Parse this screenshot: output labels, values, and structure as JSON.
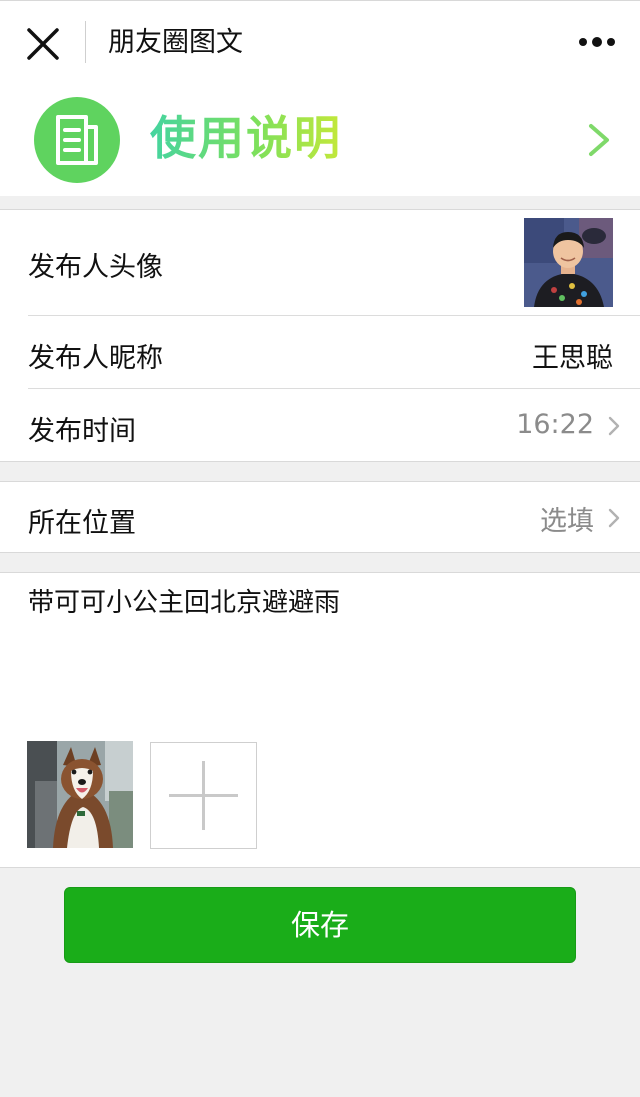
{
  "header": {
    "title": "朋友圈图文",
    "close_icon": "close-icon",
    "more_icon": "more-icon"
  },
  "banner": {
    "icon": "document-icon",
    "text": "使用说明",
    "chevron_icon": "chevron-right-icon",
    "colors": {
      "icon_bg": "#5fd35f",
      "gradient_start": "#45d4a0",
      "gradient_end": "#c4e83a"
    }
  },
  "form": {
    "avatar_label": "发布人头像",
    "nickname_label": "发布人昵称",
    "nickname_value": "王思聪",
    "time_label": "发布时间",
    "time_value": "16:22",
    "location_label": "所在位置",
    "location_placeholder": "选填"
  },
  "post": {
    "text": "带可可小公主回北京避避雨",
    "add_photo_icon": "plus-icon"
  },
  "actions": {
    "save_label": "保存",
    "accent_color": "#1aad19"
  }
}
